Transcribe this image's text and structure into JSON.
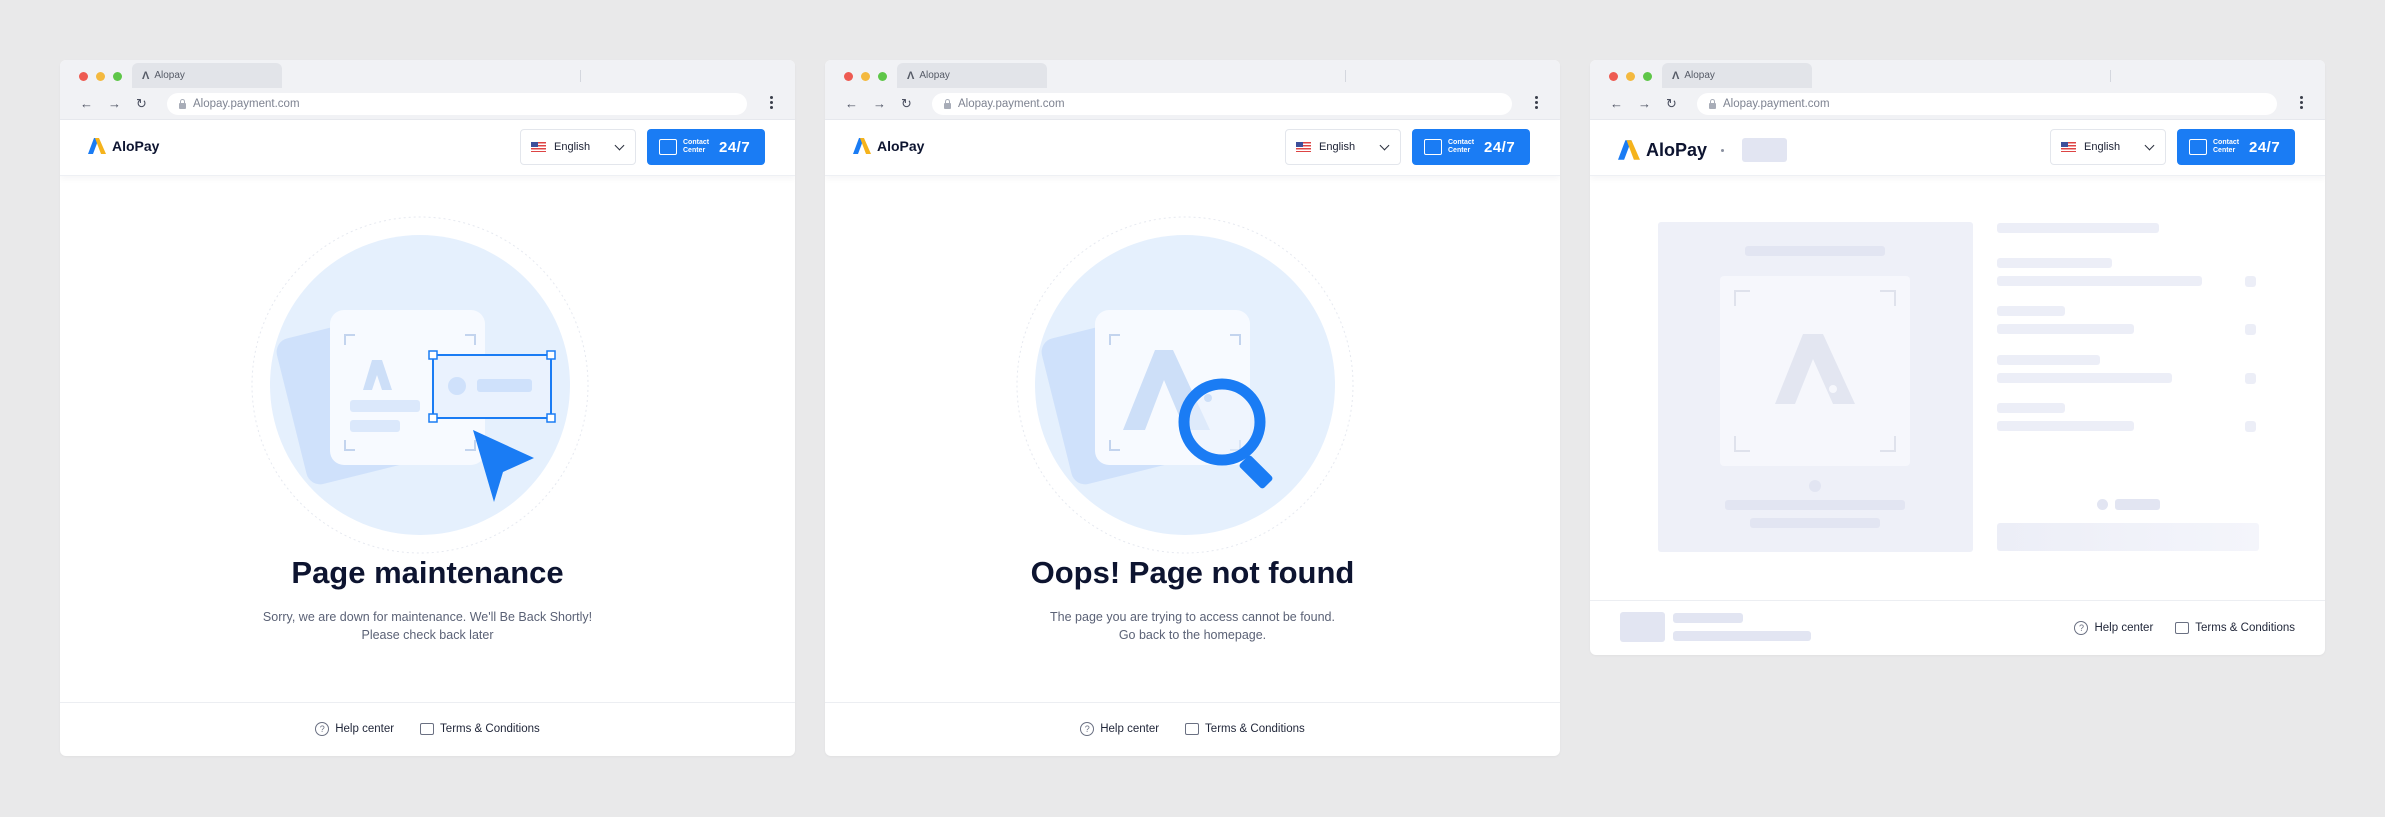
{
  "browser": {
    "tab_title": "Alopay",
    "url": "Alopay.payment.com",
    "dot_colors": [
      "#ee5b52",
      "#f4b93f",
      "#5ec648"
    ],
    "nav_icons": [
      "back-arrow-icon",
      "forward-arrow-icon",
      "reload-icon"
    ]
  },
  "header": {
    "brand": "AloPay",
    "language": "English",
    "contact_line1": "Contact",
    "contact_line2": "Center",
    "contact_hours": "24/7"
  },
  "pages": [
    {
      "title": "Page maintenance",
      "desc_line1": "Sorry, we are down for maintenance. We'll Be Back Shortly!",
      "desc_line2": "Please check back later"
    },
    {
      "title": "Oops! Page not found",
      "desc_line1": "The page you are trying to access cannot be found.",
      "desc_line2": "Go back to the homepage."
    }
  ],
  "footer": {
    "help": "Help center",
    "terms": "Terms & Conditions"
  },
  "colors": {
    "accent": "#1a7cf4",
    "circle_light": "#e5f0fd",
    "skeleton": "#eceef7",
    "background": "#e9e9ea"
  }
}
